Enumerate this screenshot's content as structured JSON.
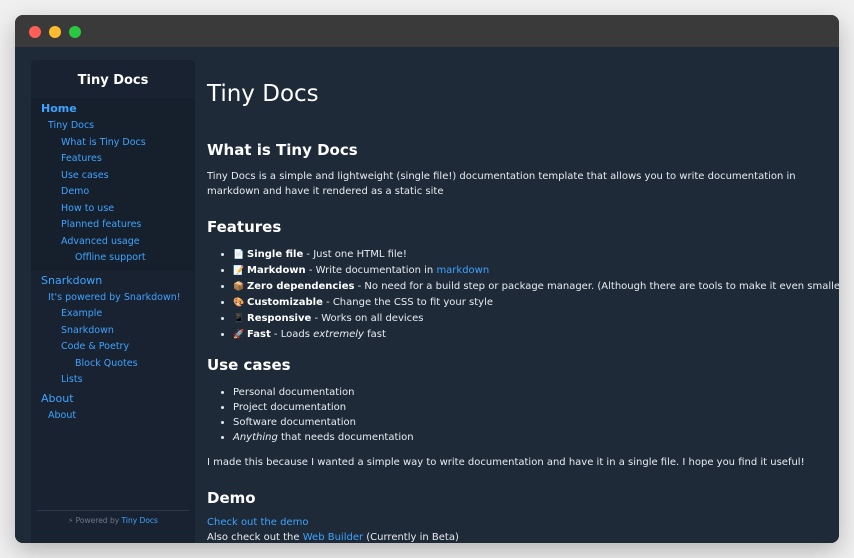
{
  "window": {
    "controls": [
      "close",
      "minimize",
      "maximize"
    ]
  },
  "sidebar": {
    "title": "Tiny Docs",
    "items": [
      {
        "label": "Home",
        "level": 1,
        "active": true
      },
      {
        "label": "Tiny Docs",
        "level": 2
      },
      {
        "label": "What is Tiny Docs",
        "level": 3
      },
      {
        "label": "Features",
        "level": 3
      },
      {
        "label": "Use cases",
        "level": 3
      },
      {
        "label": "Demo",
        "level": 3
      },
      {
        "label": "How to use",
        "level": 3
      },
      {
        "label": "Planned features",
        "level": 3
      },
      {
        "label": "Advanced usage",
        "level": 3
      },
      {
        "label": "Offline support",
        "level": 4
      },
      {
        "label": "Snarkdown",
        "level": 1
      },
      {
        "label": "It's powered by Snarkdown!",
        "level": 2
      },
      {
        "label": "Example",
        "level": 3
      },
      {
        "label": "Snarkdown",
        "level": 3
      },
      {
        "label": "Code & Poetry",
        "level": 3
      },
      {
        "label": "Block Quotes",
        "level": 4
      },
      {
        "label": "Lists",
        "level": 3
      },
      {
        "label": "About",
        "level": 1
      },
      {
        "label": "About",
        "level": 2
      }
    ],
    "footer": {
      "prefix": "⚡ Powered by",
      "link": "Tiny Docs"
    }
  },
  "main": {
    "title": "Tiny Docs",
    "what_heading": "What is Tiny Docs",
    "what_text": "Tiny Docs is a simple and lightweight (single file!) documentation template that allows you to write documentation in markdown and have it rendered as a static site",
    "features_heading": "Features",
    "features": [
      {
        "icon": "📄",
        "bold": "Single file",
        "text": " - Just one HTML file!"
      },
      {
        "icon": "📝",
        "bold": "Markdown",
        "text": " - Write documentation in ",
        "link": "markdown"
      },
      {
        "icon": "📦",
        "bold": "Zero dependencies",
        "text": " - No need for a build step or package manager. (Although there are tools to make it even smaller)"
      },
      {
        "icon": "🎨",
        "bold": "Customizable",
        "text": " - Change the CSS to fit your style"
      },
      {
        "icon": "📱",
        "bold": "Responsive",
        "text": " - Works on all devices"
      },
      {
        "icon": "🚀",
        "bold": "Fast",
        "text": " - Loads ",
        "em": "extremely",
        "tail": " fast"
      }
    ],
    "usecases_heading": "Use cases",
    "usecases": [
      {
        "text": "Personal documentation"
      },
      {
        "text": "Project documentation"
      },
      {
        "text": "Software documentation"
      },
      {
        "em": "Anything",
        "text": " that needs documentation"
      }
    ],
    "made_text": "I made this because I wanted a simple way to write documentation and have it in a single file. I hope you find it useful!",
    "demo_heading": "Demo",
    "demo_link": "Check out the demo",
    "builder_prefix": "Also check out the ",
    "builder_link": "Web Builder",
    "builder_suffix": " (Currently in Beta)"
  },
  "colors": {
    "accent": "#3fa3ff",
    "background": "#1e2a38",
    "sidebar": "#192230",
    "titlebar": "#3a3a3a"
  }
}
